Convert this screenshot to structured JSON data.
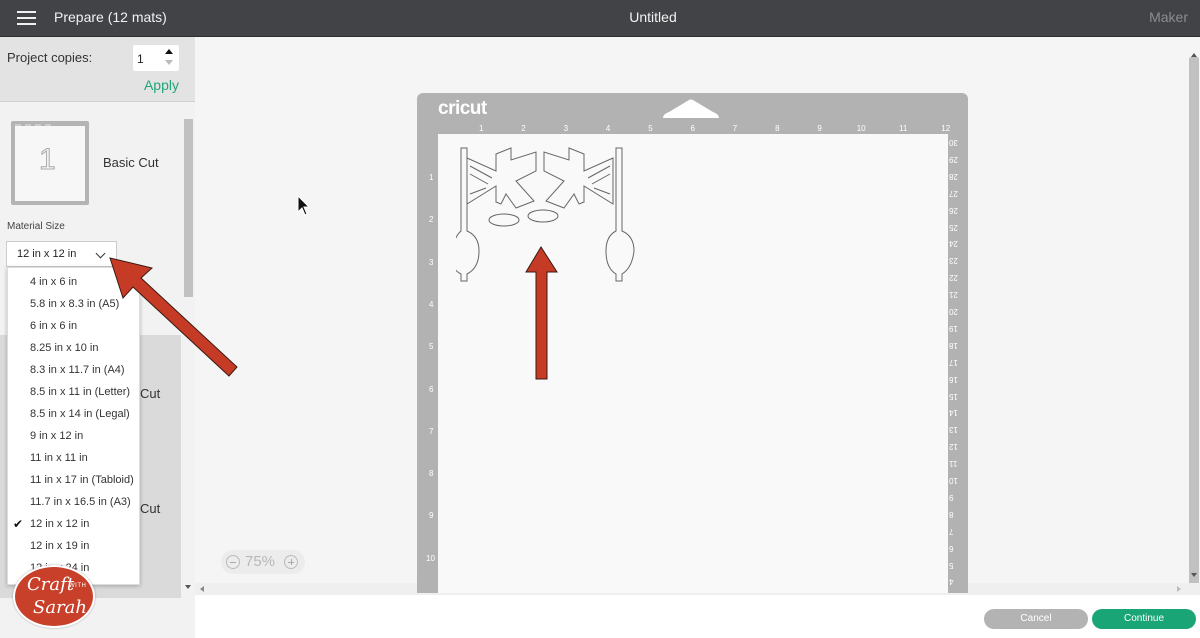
{
  "topbar": {
    "screen_title": "Prepare (12 mats)",
    "project_name": "Untitled",
    "machine": "Maker"
  },
  "sidebar": {
    "copies_label": "Project copies:",
    "copies_value": "1",
    "apply_label": "Apply",
    "mats": [
      {
        "number": "1",
        "label": "Basic Cut"
      },
      {
        "label": "Cut"
      },
      {
        "label": "Cut"
      }
    ],
    "material_size_label": "Material Size",
    "material_size_selected": "12 in x 12 in",
    "material_size_options": [
      {
        "label": "4 in x 6 in",
        "selected": false
      },
      {
        "label": "5.8 in x 8.3 in (A5)",
        "selected": false
      },
      {
        "label": "6 in x 6 in",
        "selected": false
      },
      {
        "label": "8.25 in x 10 in",
        "selected": false
      },
      {
        "label": "8.3 in x 11.7 in (A4)",
        "selected": false
      },
      {
        "label": "8.5 in x 11 in (Letter)",
        "selected": false
      },
      {
        "label": "8.5 in x 14 in (Legal)",
        "selected": false
      },
      {
        "label": "9 in x 12 in",
        "selected": false
      },
      {
        "label": "11 in x 11 in",
        "selected": false
      },
      {
        "label": "11 in x 17 in (Tabloid)",
        "selected": false
      },
      {
        "label": "11.7 in x 16.5 in (A3)",
        "selected": false
      },
      {
        "label": "12 in x 12 in",
        "selected": true
      },
      {
        "label": "12 in x 19 in",
        "selected": false
      },
      {
        "label": "12 in x 24 in",
        "selected": false
      }
    ],
    "check_glyph": "✔"
  },
  "mat": {
    "brand": "cricut",
    "top_ruler": [
      "1",
      "2",
      "3",
      "4",
      "5",
      "6",
      "7",
      "8",
      "9",
      "10",
      "11",
      "12"
    ],
    "left_ruler": [
      "1",
      "2",
      "3",
      "4",
      "5",
      "6",
      "7",
      "8",
      "9",
      "10"
    ],
    "right_ruler": [
      "30",
      "29",
      "28",
      "27",
      "26",
      "25",
      "24",
      "23",
      "22",
      "21",
      "20",
      "19",
      "18",
      "17",
      "16",
      "15",
      "14",
      "13",
      "12",
      "11",
      "10",
      "9",
      "8",
      "7",
      "6",
      "5",
      "4"
    ]
  },
  "zoom": {
    "value": "75%"
  },
  "footer": {
    "cancel_label": "Cancel",
    "continue_label": "Continue"
  },
  "watermark": {
    "line1": "Craft",
    "with": "WITH",
    "line2": "Sarah"
  },
  "colors": {
    "accent_green": "#1aa576",
    "apply_green": "#20a677",
    "topbar": "#414347",
    "annotation_red": "#c63b26"
  }
}
